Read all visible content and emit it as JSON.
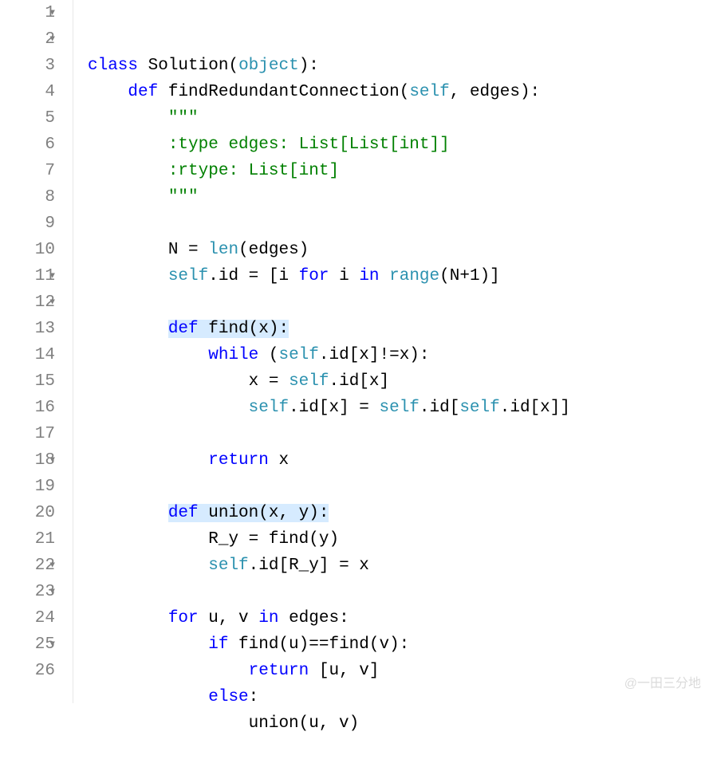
{
  "gutter": {
    "fold_markers": {
      "1": true,
      "2": true,
      "11": true,
      "12": true,
      "18": true,
      "22": true,
      "23": true,
      "25": true
    }
  },
  "lines": {
    "1": {
      "num": "1",
      "tokens": [
        {
          "t": "class ",
          "c": "kw"
        },
        {
          "t": "Solution",
          "c": "name"
        },
        {
          "t": "(",
          "c": "punct"
        },
        {
          "t": "object",
          "c": "builtin"
        },
        {
          "t": "):",
          "c": "punct"
        }
      ],
      "indent": 0
    },
    "2": {
      "num": "2",
      "tokens": [
        {
          "t": "def ",
          "c": "kw"
        },
        {
          "t": "findRedundantConnection",
          "c": "name"
        },
        {
          "t": "(",
          "c": "punct"
        },
        {
          "t": "self",
          "c": "builtin"
        },
        {
          "t": ", edges):",
          "c": "punct"
        }
      ],
      "indent": 1
    },
    "3": {
      "num": "3",
      "tokens": [
        {
          "t": "\"\"\"",
          "c": "str"
        }
      ],
      "indent": 2
    },
    "4": {
      "num": "4",
      "tokens": [
        {
          "t": ":type edges: List[List[int]]",
          "c": "str"
        }
      ],
      "indent": 2
    },
    "5": {
      "num": "5",
      "tokens": [
        {
          "t": ":rtype: List[int]",
          "c": "str"
        }
      ],
      "indent": 2
    },
    "6": {
      "num": "6",
      "tokens": [
        {
          "t": "\"\"\"",
          "c": "str"
        }
      ],
      "indent": 2
    },
    "7": {
      "num": "7",
      "tokens": [],
      "indent": 0
    },
    "8": {
      "num": "8",
      "tokens": [
        {
          "t": "N = ",
          "c": "name"
        },
        {
          "t": "len",
          "c": "builtin"
        },
        {
          "t": "(edges)",
          "c": "punct"
        }
      ],
      "indent": 2
    },
    "9": {
      "num": "9",
      "tokens": [
        {
          "t": "self",
          "c": "builtin"
        },
        {
          "t": ".id = [i ",
          "c": "name"
        },
        {
          "t": "for ",
          "c": "kw"
        },
        {
          "t": "i ",
          "c": "name"
        },
        {
          "t": "in ",
          "c": "kw"
        },
        {
          "t": "range",
          "c": "builtin"
        },
        {
          "t": "(N+",
          "c": "punct"
        },
        {
          "t": "1",
          "c": "num"
        },
        {
          "t": ")]",
          "c": "punct"
        }
      ],
      "indent": 2
    },
    "10": {
      "num": "10",
      "tokens": [],
      "indent": 0
    },
    "11": {
      "num": "11",
      "tokens": [
        {
          "t": "def ",
          "c": "kw",
          "hl": true
        },
        {
          "t": "find",
          "c": "name",
          "hl": true
        },
        {
          "t": "(x):",
          "c": "punct",
          "hl": true
        }
      ],
      "indent": 2
    },
    "12": {
      "num": "12",
      "tokens": [
        {
          "t": "while ",
          "c": "kw"
        },
        {
          "t": "(",
          "c": "punct"
        },
        {
          "t": "self",
          "c": "builtin"
        },
        {
          "t": ".id[x]!=x):",
          "c": "punct"
        }
      ],
      "indent": 3
    },
    "13": {
      "num": "13",
      "tokens": [
        {
          "t": "x = ",
          "c": "name"
        },
        {
          "t": "self",
          "c": "builtin"
        },
        {
          "t": ".id[x]",
          "c": "punct"
        }
      ],
      "indent": 4
    },
    "14": {
      "num": "14",
      "tokens": [
        {
          "t": "self",
          "c": "builtin"
        },
        {
          "t": ".id[x] = ",
          "c": "punct"
        },
        {
          "t": "self",
          "c": "builtin"
        },
        {
          "t": ".id[",
          "c": "punct"
        },
        {
          "t": "self",
          "c": "builtin"
        },
        {
          "t": ".id[x]]",
          "c": "punct"
        }
      ],
      "indent": 4
    },
    "15": {
      "num": "15",
      "tokens": [],
      "indent": 0
    },
    "16": {
      "num": "16",
      "tokens": [
        {
          "t": "return ",
          "c": "kw"
        },
        {
          "t": "x",
          "c": "name"
        }
      ],
      "indent": 3
    },
    "17": {
      "num": "17",
      "tokens": [],
      "indent": 0
    },
    "18": {
      "num": "18",
      "tokens": [
        {
          "t": "def ",
          "c": "kw",
          "hl": true
        },
        {
          "t": "union",
          "c": "name",
          "hl": true
        },
        {
          "t": "(x, y):",
          "c": "punct",
          "hl": true
        }
      ],
      "indent": 2
    },
    "19": {
      "num": "19",
      "tokens": [
        {
          "t": "R_y = find(y)",
          "c": "name"
        }
      ],
      "indent": 3
    },
    "20": {
      "num": "20",
      "tokens": [
        {
          "t": "self",
          "c": "builtin"
        },
        {
          "t": ".id[R_y] = x",
          "c": "punct"
        }
      ],
      "indent": 3
    },
    "21": {
      "num": "21",
      "tokens": [],
      "indent": 0
    },
    "22": {
      "num": "22",
      "tokens": [
        {
          "t": "for ",
          "c": "kw"
        },
        {
          "t": "u, v ",
          "c": "name"
        },
        {
          "t": "in ",
          "c": "kw"
        },
        {
          "t": "edges:",
          "c": "name"
        }
      ],
      "indent": 2
    },
    "23": {
      "num": "23",
      "tokens": [
        {
          "t": "if ",
          "c": "kw"
        },
        {
          "t": "find(u)==find(v):",
          "c": "name"
        }
      ],
      "indent": 3
    },
    "24": {
      "num": "24",
      "tokens": [
        {
          "t": "return ",
          "c": "kw"
        },
        {
          "t": "[u, v]",
          "c": "punct"
        }
      ],
      "indent": 4
    },
    "25": {
      "num": "25",
      "tokens": [
        {
          "t": "else",
          "c": "kw"
        },
        {
          "t": ":",
          "c": "punct"
        }
      ],
      "indent": 3
    },
    "26": {
      "num": "26",
      "tokens": [
        {
          "t": "union(u, v)",
          "c": "name"
        }
      ],
      "indent": 4
    }
  },
  "indent_unit": "    ",
  "watermark": "@一田三分地"
}
